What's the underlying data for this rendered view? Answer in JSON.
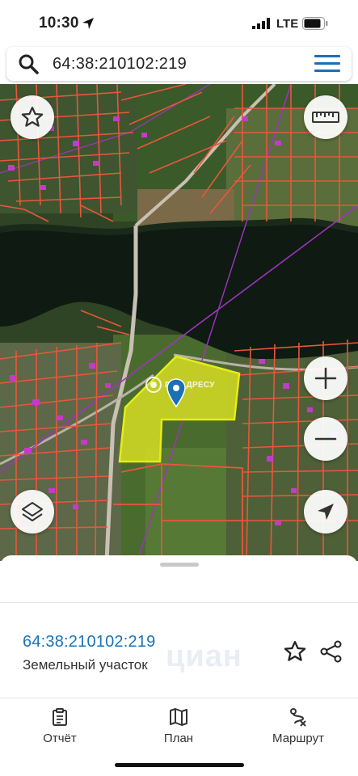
{
  "status_bar": {
    "time": "10:30",
    "network": "LTE",
    "icons": [
      "location-arrow-icon",
      "signal-icon",
      "battery-icon"
    ]
  },
  "search": {
    "value": "64:38:210102:219",
    "icons": [
      "search-icon",
      "menu-icon"
    ]
  },
  "map": {
    "watermark": "ПО АДРЕСУ",
    "parcel_fill": "#d6de22",
    "boundary_color": "#e8573a",
    "controls": [
      "star-icon",
      "ruler-icon",
      "plus-icon",
      "minus-icon",
      "layers-icon",
      "navigation-arrow-icon"
    ]
  },
  "sheet": {
    "parcel_id": "64:38:210102:219",
    "parcel_type": "Земельный участок",
    "watermark_logo": "циан",
    "actions": [
      "favorite-icon",
      "share-icon"
    ]
  },
  "tabs": [
    {
      "label": "Отчёт",
      "icon": "report-icon"
    },
    {
      "label": "План",
      "icon": "map-icon"
    },
    {
      "label": "Маршрут",
      "icon": "route-icon"
    }
  ],
  "colors": {
    "accent": "#1b72b8",
    "parcel_highlight": "#d6de22",
    "cadastral_lines": "#e8573a",
    "building_magenta": "#c23cc8"
  }
}
